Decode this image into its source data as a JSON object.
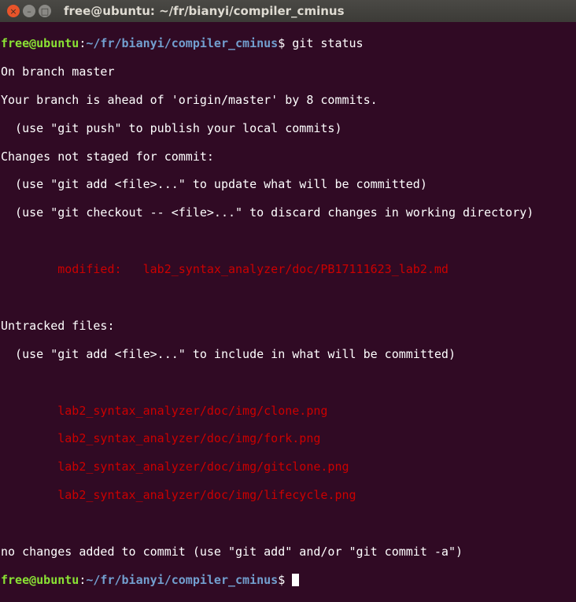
{
  "window": {
    "title": "free@ubuntu: ~/fr/bianyi/compiler_cminus",
    "close": "×",
    "minimize": "–",
    "maximize": "□"
  },
  "prompt": {
    "user": "free@ubuntu",
    "sep": ":",
    "path": "~/fr/bianyi/compiler_cminus",
    "symbol": "$ "
  },
  "command": "git status",
  "output": [
    "On branch master",
    "Your branch is ahead of 'origin/master' by 8 commits.",
    "  (use \"git push\" to publish your local commits)",
    "Changes not staged for commit:",
    "  (use \"git add <file>...\" to update what will be committed)",
    "  (use \"git checkout -- <file>...\" to discard changes in working directory)"
  ],
  "modified": "        modified:   lab2_syntax_analyzer/doc/PB17111623_lab2.md",
  "untracked_header": [
    "Untracked files:",
    "  (use \"git add <file>...\" to include in what will be committed)"
  ],
  "untracked": [
    "        lab2_syntax_analyzer/doc/img/clone.png",
    "        lab2_syntax_analyzer/doc/img/fork.png",
    "        lab2_syntax_analyzer/doc/img/gitclone.png",
    "        lab2_syntax_analyzer/doc/img/lifecycle.png"
  ],
  "footer": "no changes added to commit (use \"git add\" and/or \"git commit -a\")",
  "colors": {
    "background": "#300a24",
    "user": "#8ae234",
    "path": "#729fcf",
    "red": "#cc0000"
  }
}
